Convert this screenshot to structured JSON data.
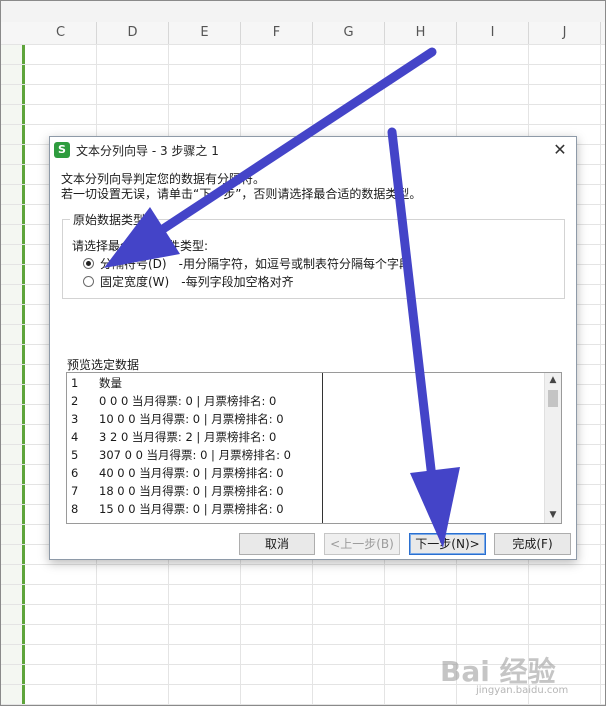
{
  "spreadsheet": {
    "columns": [
      "C",
      "D",
      "E",
      "F",
      "G",
      "H",
      "I",
      "J"
    ]
  },
  "dialog": {
    "title": "文本分列向导 - 3 步骤之 1",
    "app_icon_letter": "S",
    "close_glyph": "✕",
    "description_line1": "文本分列向导判定您的数据有分隔符。",
    "description_line2": "若一切设置无误，请单击“下一步”，否则请选择最合适的数据类型。",
    "group_label": "原始数据类型",
    "prompt": "请选择最合适的文件类型:",
    "options": [
      {
        "label": "分隔符号(D)",
        "description": "-用分隔字符，如逗号或制表符分隔每个字段",
        "checked": true
      },
      {
        "label": "固定宽度(W)",
        "description": "-每列字段加空格对齐",
        "checked": false
      }
    ],
    "preview_label": "预览选定数据",
    "preview_rows": [
      {
        "num": "1",
        "text": "数量"
      },
      {
        "num": "2",
        "text": "0 0 0 当月得票: 0 | 月票榜排名: 0"
      },
      {
        "num": "3",
        "text": "10 0 0 当月得票: 0 | 月票榜排名: 0"
      },
      {
        "num": "4",
        "text": "3 2 0 当月得票: 2 | 月票榜排名: 0"
      },
      {
        "num": "5",
        "text": "307 0 0 当月得票: 0 | 月票榜排名: 0"
      },
      {
        "num": "6",
        "text": "40 0 0 当月得票: 0 | 月票榜排名: 0"
      },
      {
        "num": "7",
        "text": "18 0 0 当月得票: 0 | 月票榜排名: 0"
      },
      {
        "num": "8",
        "text": "15 0 0 当月得票: 0 | 月票榜排名: 0"
      }
    ],
    "buttons": {
      "cancel": "取消",
      "back": "<上一步(B)",
      "next": "下一步(N)>",
      "finish": "完成(F)"
    }
  },
  "watermark": {
    "logo": "Bai 经验",
    "url": "jingyan.baidu.com"
  },
  "colors": {
    "arrow": "#4444c8",
    "row_edge": "#5ea43b",
    "app_icon": "#2e9c3e"
  }
}
